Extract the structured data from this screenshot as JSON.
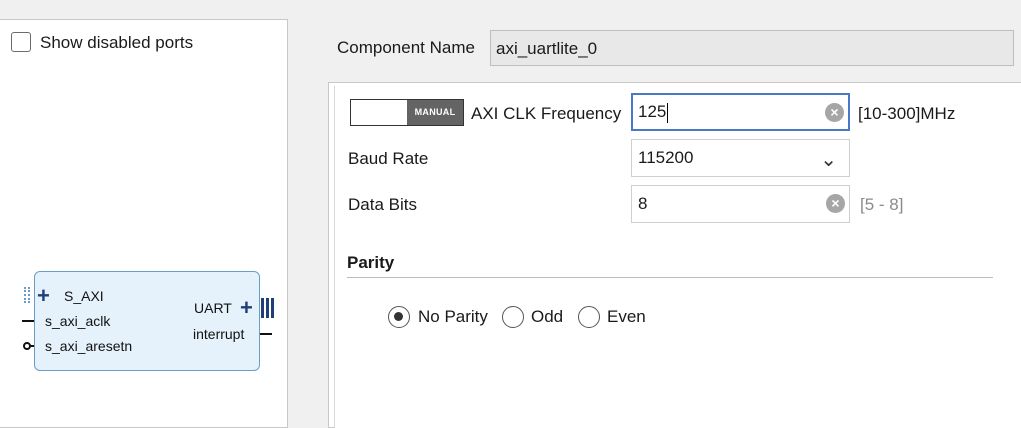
{
  "left": {
    "show_disabled_ports_label": "Show disabled ports",
    "show_disabled_ports_checked": false,
    "block": {
      "s_axi": "S_AXI",
      "s_axi_aclk": "s_axi_aclk",
      "s_axi_aresetn": "s_axi_aresetn",
      "uart": "UART",
      "interrupt": "interrupt"
    }
  },
  "component": {
    "label": "Component Name",
    "value": "axi_uartlite_0"
  },
  "params": {
    "mode_toggle": "MANUAL",
    "axi_clk": {
      "label": "AXI CLK Frequency",
      "value": "125",
      "range": "[10-300]MHz"
    },
    "baud": {
      "label": "Baud Rate",
      "value": "115200"
    },
    "data_bits": {
      "label": "Data Bits",
      "value": "8",
      "range": "[5 - 8]"
    },
    "parity": {
      "title": "Parity",
      "options": [
        "No Parity",
        "Odd",
        "Even"
      ],
      "selected": "No Parity"
    }
  },
  "icons": {
    "clear": "clear-circle-x-icon",
    "chevron": "chevron-down-icon",
    "plus": "plus-icon",
    "bus": "bus-bars-icon"
  },
  "colors": {
    "focus_border": "#4a78c8",
    "block_fill": "#e6f2fb",
    "block_border": "#6a9ec6",
    "port_plus": "#1f3f78",
    "toggle_knob": "#646464"
  }
}
